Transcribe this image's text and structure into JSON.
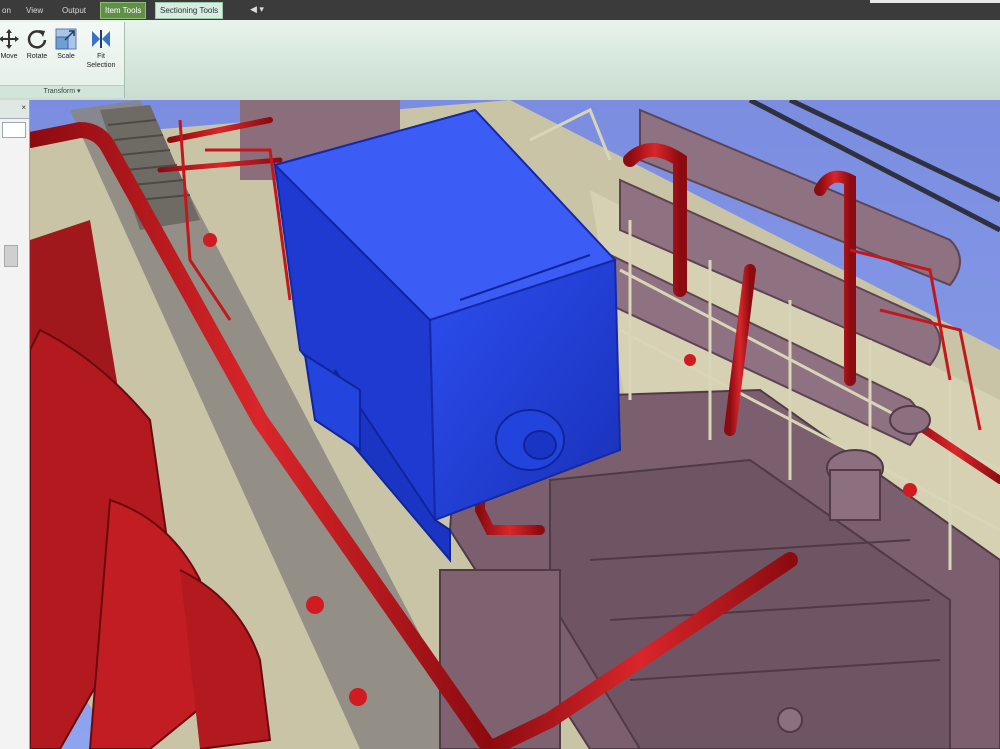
{
  "tabs": [
    "on",
    "View",
    "Output",
    "Item Tools",
    "Sectioning Tools"
  ],
  "quick_access": "◀ ▾",
  "ribbon": {
    "buttons": [
      {
        "label": "Move"
      },
      {
        "label": "Rotate"
      },
      {
        "label": "Scale"
      },
      {
        "label": "Fit Selection"
      }
    ],
    "group_label": "Transform ▾"
  },
  "panel": {
    "close": "×"
  },
  "colors": {
    "sky": "#7a8fe0",
    "deck": "#c9c4a6",
    "pipe_red": "#c4171c",
    "machinery": "#7b5f6e",
    "selected_blue": "#1f3fd6"
  }
}
